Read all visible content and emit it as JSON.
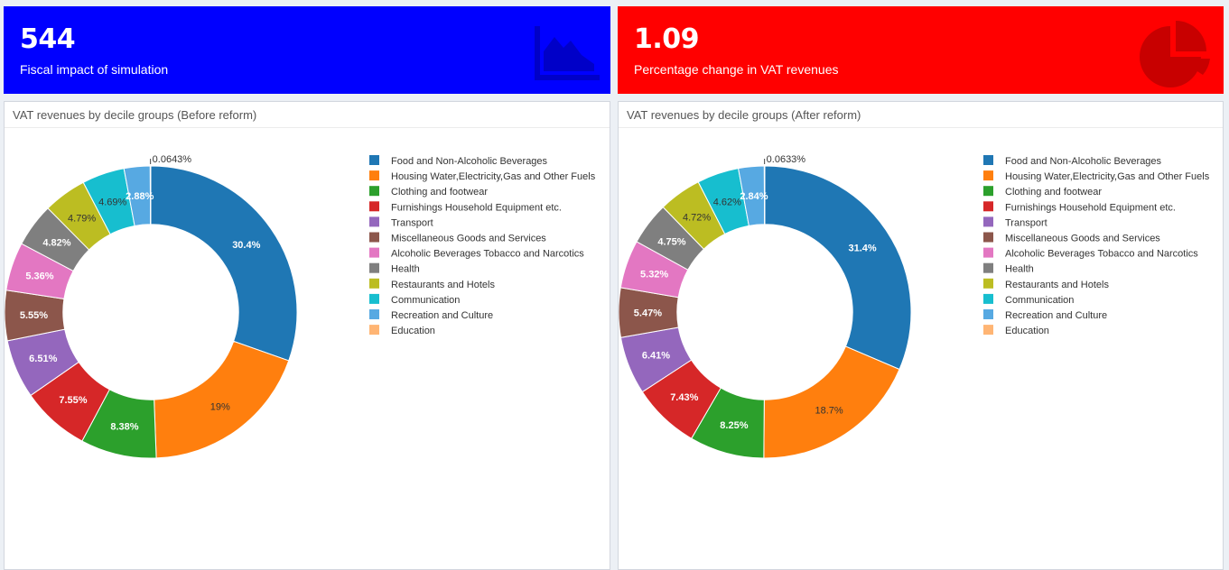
{
  "kpis": [
    {
      "value": "544",
      "label": "Fiscal impact of simulation",
      "color": "#0000ff",
      "icon": "area-chart-icon"
    },
    {
      "value": "1.09",
      "label": "Percentage change in VAT revenues",
      "color": "#ff0000",
      "icon": "pie-chart-icon"
    }
  ],
  "chart_data": [
    {
      "type": "pie",
      "title": "VAT revenues by decile groups (Before reform)",
      "labels": [
        "Food and Non-Alcoholic Beverages",
        "Housing Water,Electricity,Gas and Other Fuels",
        "Clothing and footwear",
        "Furnishings Household Equipment etc.",
        "Transport",
        "Miscellaneous Goods and Services",
        "Alcoholic Beverages Tobacco and Narcotics",
        "Health",
        "Restaurants and Hotels",
        "Communication",
        "Recreation and Culture",
        "Education"
      ],
      "values": [
        30.4,
        19,
        8.38,
        7.55,
        6.51,
        5.55,
        5.36,
        4.82,
        4.79,
        4.69,
        2.88,
        0.0643
      ],
      "value_labels": [
        "30.4%",
        "19%",
        "8.38%",
        "7.55%",
        "6.51%",
        "5.55%",
        "5.36%",
        "4.82%",
        "4.79%",
        "4.69%",
        "2.88%",
        "0.0643%"
      ],
      "colors": [
        "#1f77b4",
        "#ff7f0e",
        "#2ca02c",
        "#d62728",
        "#9467bd",
        "#8c564b",
        "#e377c2",
        "#7f7f7f",
        "#bcbd22",
        "#17becf",
        "#57a9e2",
        "#ffb574"
      ],
      "hole": 0.6,
      "legend": "right"
    },
    {
      "type": "pie",
      "title": "VAT revenues by decile groups (After reform)",
      "labels": [
        "Food and Non-Alcoholic Beverages",
        "Housing Water,Electricity,Gas and Other Fuels",
        "Clothing and footwear",
        "Furnishings Household Equipment etc.",
        "Transport",
        "Miscellaneous Goods and Services",
        "Alcoholic Beverages Tobacco and Narcotics",
        "Health",
        "Restaurants and Hotels",
        "Communication",
        "Recreation and Culture",
        "Education"
      ],
      "values": [
        31.4,
        18.7,
        8.25,
        7.43,
        6.41,
        5.47,
        5.32,
        4.75,
        4.72,
        4.62,
        2.84,
        0.0633
      ],
      "value_labels": [
        "31.4%",
        "18.7%",
        "8.25%",
        "7.43%",
        "6.41%",
        "5.47%",
        "5.32%",
        "4.75%",
        "4.72%",
        "4.62%",
        "2.84%",
        "0.0633%"
      ],
      "colors": [
        "#1f77b4",
        "#ff7f0e",
        "#2ca02c",
        "#d62728",
        "#9467bd",
        "#8c564b",
        "#e377c2",
        "#7f7f7f",
        "#bcbd22",
        "#17becf",
        "#57a9e2",
        "#ffb574"
      ],
      "hole": 0.6,
      "legend": "right"
    }
  ]
}
